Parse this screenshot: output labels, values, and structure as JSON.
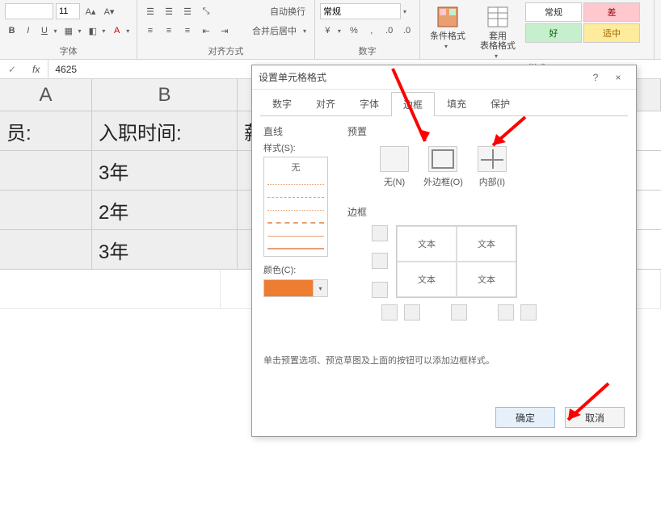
{
  "ribbon": {
    "font": {
      "size": "11",
      "bold": "B",
      "italic": "I",
      "underline": "U",
      "group_label": "字体"
    },
    "alignment": {
      "wrap": "自动换行",
      "merge": "合并后居中",
      "group_label": "对齐方式"
    },
    "number": {
      "format": "常规",
      "percent": "%",
      "comma": ",",
      "group_label": "数字"
    },
    "styles": {
      "cond_format": "条件格式",
      "table_format": "套用\n表格格式",
      "normal": "常规",
      "bad": "差",
      "good": "好",
      "neutral": "适中",
      "group_label": "样式"
    }
  },
  "formula": {
    "fx": "fx",
    "value": "4625"
  },
  "sheet": {
    "cols": {
      "A": "A",
      "B": "B"
    },
    "rows": [
      {
        "A": "员:",
        "B": "入职时间:",
        "C": "薪"
      },
      {
        "A": "",
        "B": "3年",
        "C": ""
      },
      {
        "A": "",
        "B": "2年",
        "C": ""
      },
      {
        "A": "",
        "B": "3年",
        "C": ""
      }
    ]
  },
  "dialog": {
    "title": "设置单元格格式",
    "help": "?",
    "close": "×",
    "tabs": {
      "number": "数字",
      "align": "对齐",
      "font": "字体",
      "border": "边框",
      "fill": "填充",
      "protect": "保护"
    },
    "line": {
      "section": "直线",
      "style": "样式(S):",
      "none": "无",
      "color": "颜色(C):",
      "color_value": "#ed7d31"
    },
    "preset": {
      "section": "预置",
      "none": "无(N)",
      "outline": "外边框(O)",
      "inside": "内部(I)"
    },
    "border_section": "边框",
    "preview_text": "文本",
    "hint": "单击预置选项、预览草图及上面的按钮可以添加边框样式。",
    "ok": "确定",
    "cancel": "取消"
  }
}
